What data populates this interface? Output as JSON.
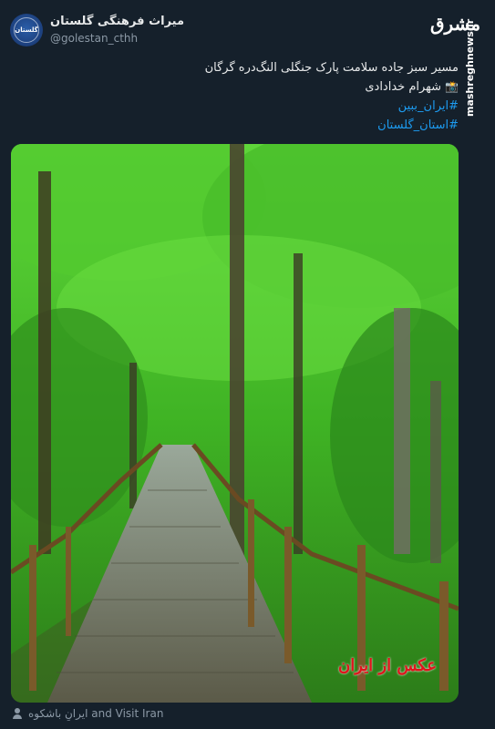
{
  "account": {
    "display_name": "میراث فرهنگی گلستان",
    "handle": "@golestan_cthh"
  },
  "brand": {
    "logo_text": "مشرق",
    "vertical_url": "mashreghnews.ir"
  },
  "tweet": {
    "line1": "مسیر سبز جاده سلامت پارک جنگلی النگ‌دره گرگان",
    "photographer": "شهرام خدادادی",
    "camera_icon": "camera-icon",
    "hashtags": [
      "#ایران_ببین",
      "#استان_گلستان"
    ]
  },
  "photo": {
    "watermark": "عکس از ایران"
  },
  "footer": {
    "tagged": "ایرانِ باشکوه and Visit Iran",
    "icon": "person-icon"
  },
  "colors": {
    "background": "#15202b",
    "link": "#1d9bf0",
    "muted": "#8b98a5"
  }
}
